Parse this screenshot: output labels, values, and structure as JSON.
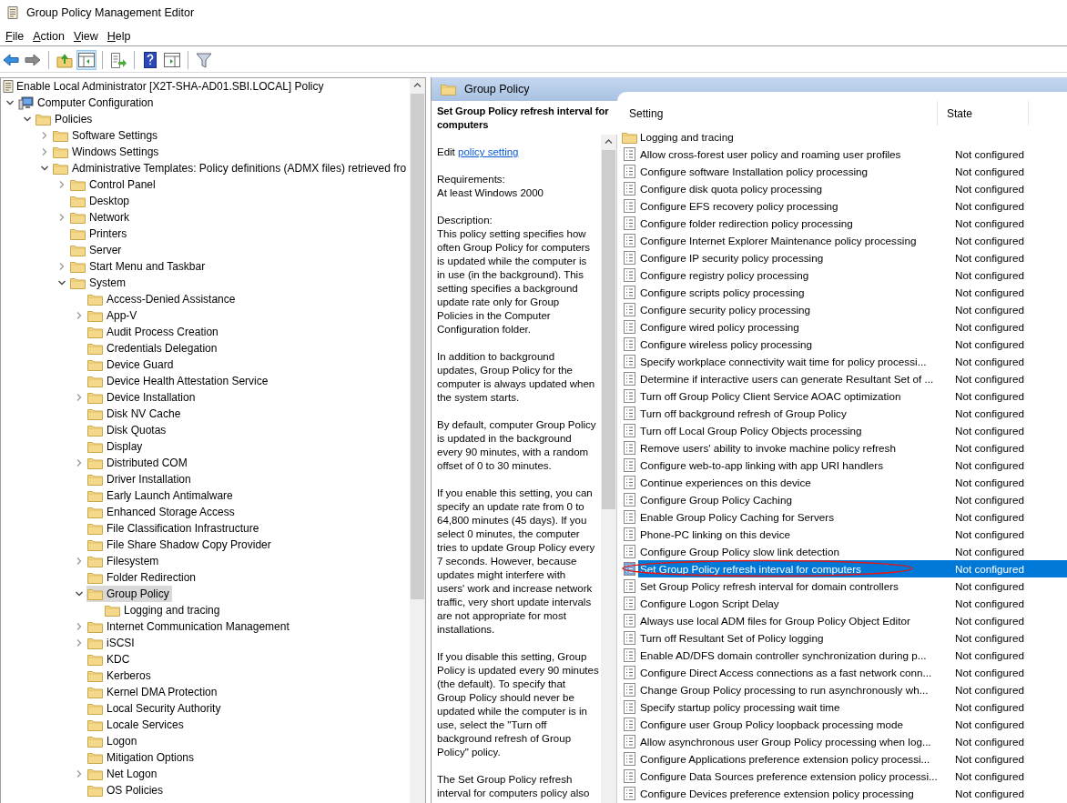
{
  "window": {
    "title": "Group Policy Management Editor"
  },
  "menu": [
    "File",
    "Action",
    "View",
    "Help"
  ],
  "toolbar": [
    {
      "kind": "back",
      "pressed": false
    },
    {
      "kind": "forward",
      "pressed": false
    },
    {
      "kind": "separator"
    },
    {
      "kind": "up",
      "pressed": false
    },
    {
      "kind": "tree",
      "pressed": true
    },
    {
      "kind": "separator"
    },
    {
      "kind": "export",
      "pressed": false
    },
    {
      "kind": "separator"
    },
    {
      "kind": "help",
      "pressed": false
    },
    {
      "kind": "panel",
      "pressed": false
    },
    {
      "kind": "separator"
    },
    {
      "kind": "filter",
      "pressed": false
    }
  ],
  "tree": {
    "root": "Enable Local Administrator [X2T-SHA-AD01.SBI.LOCAL] Policy",
    "children": [
      {
        "label": "Computer Configuration",
        "expanded": true,
        "selected": false,
        "children": [
          {
            "label": "Policies",
            "expanded": true,
            "selected": false,
            "children": [
              {
                "label": "Software Settings",
                "expanded": false,
                "selected": false
              },
              {
                "label": "Windows Settings",
                "expanded": false,
                "selected": false
              },
              {
                "label": "Administrative Templates: Policy definitions (ADMX files) retrieved fro",
                "expanded": true,
                "selected": false,
                "children": [
                  {
                    "label": "Control Panel",
                    "expanded": false,
                    "selected": false
                  },
                  {
                    "label": "Desktop",
                    "selected": false
                  },
                  {
                    "label": "Network",
                    "expanded": false,
                    "selected": false
                  },
                  {
                    "label": "Printers",
                    "selected": false
                  },
                  {
                    "label": "Server",
                    "selected": false
                  },
                  {
                    "label": "Start Menu and Taskbar",
                    "expanded": false,
                    "selected": false
                  },
                  {
                    "label": "System",
                    "expanded": true,
                    "selected": false,
                    "children": [
                      {
                        "label": "Access-Denied Assistance",
                        "selected": false
                      },
                      {
                        "label": "App-V",
                        "expanded": false,
                        "selected": false
                      },
                      {
                        "label": "Audit Process Creation",
                        "selected": false
                      },
                      {
                        "label": "Credentials Delegation",
                        "selected": false
                      },
                      {
                        "label": "Device Guard",
                        "selected": false
                      },
                      {
                        "label": "Device Health Attestation Service",
                        "selected": false
                      },
                      {
                        "label": "Device Installation",
                        "expanded": false,
                        "selected": false
                      },
                      {
                        "label": "Disk NV Cache",
                        "selected": false
                      },
                      {
                        "label": "Disk Quotas",
                        "selected": false
                      },
                      {
                        "label": "Display",
                        "selected": false
                      },
                      {
                        "label": "Distributed COM",
                        "expanded": false,
                        "selected": false
                      },
                      {
                        "label": "Driver Installation",
                        "selected": false
                      },
                      {
                        "label": "Early Launch Antimalware",
                        "selected": false
                      },
                      {
                        "label": "Enhanced Storage Access",
                        "selected": false
                      },
                      {
                        "label": "File Classification Infrastructure",
                        "selected": false
                      },
                      {
                        "label": "File Share Shadow Copy Provider",
                        "selected": false
                      },
                      {
                        "label": "Filesystem",
                        "expanded": false,
                        "selected": false
                      },
                      {
                        "label": "Folder Redirection",
                        "selected": false
                      },
                      {
                        "label": "Group Policy",
                        "expanded": true,
                        "selected": true,
                        "children": [
                          {
                            "label": "Logging and tracing",
                            "selected": false
                          }
                        ]
                      },
                      {
                        "label": "Internet Communication Management",
                        "expanded": false,
                        "selected": false
                      },
                      {
                        "label": "iSCSI",
                        "expanded": false,
                        "selected": false
                      },
                      {
                        "label": "KDC",
                        "selected": false
                      },
                      {
                        "label": "Kerberos",
                        "selected": false
                      },
                      {
                        "label": "Kernel DMA Protection",
                        "selected": false
                      },
                      {
                        "label": "Local Security Authority",
                        "selected": false
                      },
                      {
                        "label": "Locale Services",
                        "selected": false
                      },
                      {
                        "label": "Logon",
                        "selected": false
                      },
                      {
                        "label": "Mitigation Options",
                        "selected": false
                      },
                      {
                        "label": "Net Logon",
                        "expanded": false,
                        "selected": false
                      },
                      {
                        "label": "OS Policies",
                        "selected": false
                      }
                    ]
                  }
                ]
              }
            ]
          }
        ]
      }
    ]
  },
  "details": {
    "header": "Group Policy",
    "title": "Set Group Policy refresh interval for computers",
    "edit_prefix": "Edit",
    "edit_link": "policy setting",
    "requirements_label": "Requirements:",
    "requirements": "At least Windows 2000",
    "description_label": "Description:",
    "paragraphs": [
      [
        "This policy setting specifies how",
        "often Group Policy for computers",
        "is updated while the computer is",
        "in use (in the background). This",
        "setting specifies a background",
        "update rate only for Group",
        "Policies in the Computer",
        "Configuration folder."
      ],
      [
        "In addition to background",
        "updates, Group Policy for the",
        "computer is always updated when",
        "the system starts."
      ],
      [
        "By default, computer Group Policy",
        "is updated in the background",
        "every 90 minutes, with a random",
        "offset of 0 to 30 minutes."
      ],
      [
        "If you enable this setting, you can",
        "specify an update rate from 0 to",
        "64,800 minutes (45 days). If you",
        "select 0 minutes, the computer",
        "tries to update Group Policy every",
        "7 seconds. However, because",
        "updates might interfere with",
        "users' work and increase network",
        "traffic, very short update intervals",
        "are not appropriate for most",
        "installations."
      ],
      [
        "If you disable this setting, Group",
        "Policy is updated every 90 minutes",
        "(the default). To specify that",
        "Group Policy should never be",
        "updated while the computer is in",
        "use, select the \"Turn off",
        "background refresh of Group",
        "Policy\" policy."
      ],
      [
        "The Set Group Policy refresh",
        "interval for computers policy also"
      ]
    ]
  },
  "settings": {
    "columns": [
      "Setting",
      "State"
    ],
    "rows": [
      {
        "kind": "folder",
        "name": "Logging and tracing",
        "selected": false,
        "circled": false
      },
      {
        "kind": "setting",
        "name": "Allow cross-forest user policy and roaming user profiles",
        "state": "Not configured",
        "selected": false,
        "circled": false
      },
      {
        "kind": "setting",
        "name": "Configure software Installation policy processing",
        "state": "Not configured",
        "selected": false,
        "circled": false
      },
      {
        "kind": "setting",
        "name": "Configure disk quota policy processing",
        "state": "Not configured",
        "selected": false,
        "circled": false
      },
      {
        "kind": "setting",
        "name": "Configure EFS recovery policy processing",
        "state": "Not configured",
        "selected": false,
        "circled": false
      },
      {
        "kind": "setting",
        "name": "Configure folder redirection policy processing",
        "state": "Not configured",
        "selected": false,
        "circled": false
      },
      {
        "kind": "setting",
        "name": "Configure Internet Explorer Maintenance policy processing",
        "state": "Not configured",
        "selected": false,
        "circled": false
      },
      {
        "kind": "setting",
        "name": "Configure IP security policy processing",
        "state": "Not configured",
        "selected": false,
        "circled": false
      },
      {
        "kind": "setting",
        "name": "Configure registry policy processing",
        "state": "Not configured",
        "selected": false,
        "circled": false
      },
      {
        "kind": "setting",
        "name": "Configure scripts policy processing",
        "state": "Not configured",
        "selected": false,
        "circled": false
      },
      {
        "kind": "setting",
        "name": "Configure security policy processing",
        "state": "Not configured",
        "selected": false,
        "circled": false
      },
      {
        "kind": "setting",
        "name": "Configure wired policy processing",
        "state": "Not configured",
        "selected": false,
        "circled": false
      },
      {
        "kind": "setting",
        "name": "Configure wireless policy processing",
        "state": "Not configured",
        "selected": false,
        "circled": false
      },
      {
        "kind": "setting",
        "name": "Specify workplace connectivity wait time for policy processi...",
        "state": "Not configured",
        "selected": false,
        "circled": false
      },
      {
        "kind": "setting",
        "name": "Determine if interactive users can generate Resultant Set of ...",
        "state": "Not configured",
        "selected": false,
        "circled": false
      },
      {
        "kind": "setting",
        "name": "Turn off Group Policy Client Service AOAC optimization",
        "state": "Not configured",
        "selected": false,
        "circled": false
      },
      {
        "kind": "setting",
        "name": "Turn off background refresh of Group Policy",
        "state": "Not configured",
        "selected": false,
        "circled": false
      },
      {
        "kind": "setting",
        "name": "Turn off Local Group Policy Objects processing",
        "state": "Not configured",
        "selected": false,
        "circled": false
      },
      {
        "kind": "setting",
        "name": "Remove users' ability to invoke machine policy refresh",
        "state": "Not configured",
        "selected": false,
        "circled": false
      },
      {
        "kind": "setting",
        "name": "Configure web-to-app linking with app URI handlers",
        "state": "Not configured",
        "selected": false,
        "circled": false
      },
      {
        "kind": "setting",
        "name": "Continue experiences on this device",
        "state": "Not configured",
        "selected": false,
        "circled": false
      },
      {
        "kind": "setting",
        "name": "Configure Group Policy Caching",
        "state": "Not configured",
        "selected": false,
        "circled": false
      },
      {
        "kind": "setting",
        "name": "Enable Group Policy Caching for Servers",
        "state": "Not configured",
        "selected": false,
        "circled": false
      },
      {
        "kind": "setting",
        "name": "Phone-PC linking on this device",
        "state": "Not configured",
        "selected": false,
        "circled": false
      },
      {
        "kind": "setting",
        "name": "Configure Group Policy slow link detection",
        "state": "Not configured",
        "selected": false,
        "circled": false
      },
      {
        "kind": "setting",
        "name": "Set Group Policy refresh interval for computers",
        "state": "Not configured",
        "selected": true,
        "circled": true
      },
      {
        "kind": "setting",
        "name": "Set Group Policy refresh interval for domain controllers",
        "state": "Not configured",
        "selected": false,
        "circled": false
      },
      {
        "kind": "setting",
        "name": "Configure Logon Script Delay",
        "state": "Not configured",
        "selected": false,
        "circled": false
      },
      {
        "kind": "setting",
        "name": "Always use local ADM files for Group Policy Object Editor",
        "state": "Not configured",
        "selected": false,
        "circled": false
      },
      {
        "kind": "setting",
        "name": "Turn off Resultant Set of Policy logging",
        "state": "Not configured",
        "selected": false,
        "circled": false
      },
      {
        "kind": "setting",
        "name": "Enable AD/DFS domain controller synchronization during p...",
        "state": "Not configured",
        "selected": false,
        "circled": false
      },
      {
        "kind": "setting",
        "name": "Configure Direct Access connections as a fast network conn...",
        "state": "Not configured",
        "selected": false,
        "circled": false
      },
      {
        "kind": "setting",
        "name": "Change Group Policy processing to run asynchronously wh...",
        "state": "Not configured",
        "selected": false,
        "circled": false
      },
      {
        "kind": "setting",
        "name": "Specify startup policy processing wait time",
        "state": "Not configured",
        "selected": false,
        "circled": false
      },
      {
        "kind": "setting",
        "name": "Configure user Group Policy loopback processing mode",
        "state": "Not configured",
        "selected": false,
        "circled": false
      },
      {
        "kind": "setting",
        "name": "Allow asynchronous user Group Policy processing when log...",
        "state": "Not configured",
        "selected": false,
        "circled": false
      },
      {
        "kind": "setting",
        "name": "Configure Applications preference extension policy processi...",
        "state": "Not configured",
        "selected": false,
        "circled": false
      },
      {
        "kind": "setting",
        "name": "Configure Data Sources preference extension policy processi...",
        "state": "Not configured",
        "selected": false,
        "circled": false
      },
      {
        "kind": "setting",
        "name": "Configure Devices preference extension policy processing",
        "state": "Not configured",
        "selected": false,
        "circled": false
      }
    ]
  }
}
